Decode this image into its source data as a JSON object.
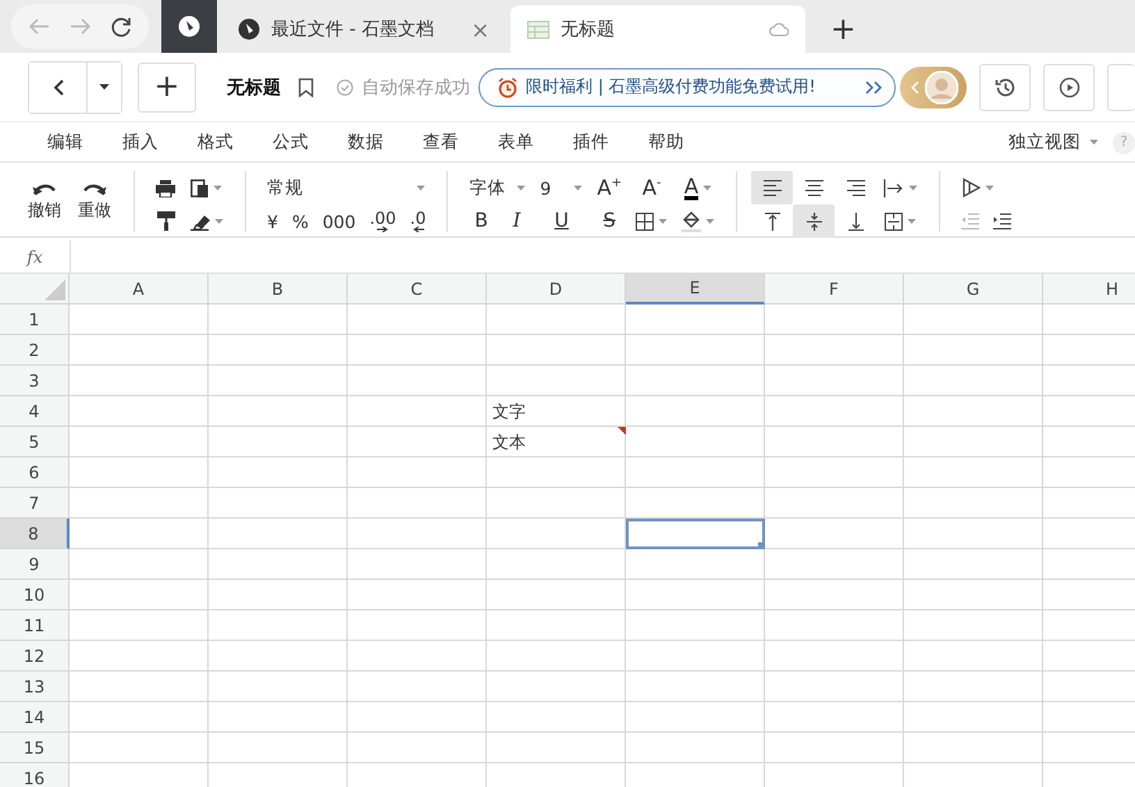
{
  "browser": {
    "tabs": [
      {
        "kind": "app",
        "selected": false
      },
      {
        "kind": "page",
        "label": "最近文件 - 石墨文档",
        "selected": false,
        "close": "×"
      },
      {
        "kind": "sheet",
        "label": "无标题",
        "selected": true
      }
    ],
    "new_tab": "+"
  },
  "doc_bar": {
    "new": "+",
    "title": "无标题",
    "save_status": "自动保存成功",
    "promo": "限时福利 | 石墨高级付费功能免费试用!"
  },
  "menu": {
    "items": [
      "编辑",
      "插入",
      "格式",
      "公式",
      "数据",
      "查看",
      "表单",
      "插件",
      "帮助"
    ],
    "view_mode": "独立视图",
    "help": "?"
  },
  "ribbon": {
    "undo": "撤销",
    "redo": "重做",
    "number_format": "常规",
    "currency": "¥",
    "percent": "%",
    "thousands": "000",
    "add_decimal": ".00",
    "remove_decimal": ".0",
    "font": "字体",
    "font_size": "9",
    "grow_font": "A$^{+}$",
    "shrink_font": "A$^{-}$",
    "font_color": "A",
    "bold": "B",
    "italic": "I",
    "underline": "U",
    "strikethrough": "S",
    "horizontal_align": [
      {
        "kind": "left",
        "selected": true
      },
      {
        "kind": "center",
        "selected": false
      },
      {
        "kind": "right",
        "selected": false
      }
    ],
    "vertical_align": [
      {
        "kind": "top",
        "selected": false
      },
      {
        "kind": "middle",
        "selected": true
      },
      {
        "kind": "bottom",
        "selected": false
      }
    ]
  },
  "formula_bar": {
    "label": "fx"
  },
  "sheet": {
    "columns": [
      {
        "label": "A",
        "selected": false
      },
      {
        "label": "B",
        "selected": false
      },
      {
        "label": "C",
        "selected": false
      },
      {
        "label": "D",
        "selected": false
      },
      {
        "label": "E",
        "selected": true
      },
      {
        "label": "F",
        "selected": false
      },
      {
        "label": "G",
        "selected": false
      },
      {
        "label": "H",
        "selected": false
      }
    ],
    "rows": [
      {
        "label": "1",
        "selected": false
      },
      {
        "label": "2",
        "selected": false
      },
      {
        "label": "3",
        "selected": false
      },
      {
        "label": "4",
        "selected": false,
        "cells": [
          null,
          null,
          null,
          {
            "text": "文字",
            "comment": false
          },
          null,
          null,
          null,
          null
        ]
      },
      {
        "label": "5",
        "selected": false,
        "cells": [
          null,
          null,
          null,
          {
            "text": "文本",
            "comment": true
          },
          null,
          null,
          null,
          null
        ]
      },
      {
        "label": "6",
        "selected": false
      },
      {
        "label": "7",
        "selected": false
      },
      {
        "label": "8",
        "selected": true
      },
      {
        "label": "9",
        "selected": false
      },
      {
        "label": "10",
        "selected": false
      },
      {
        "label": "11",
        "selected": false
      },
      {
        "label": "12",
        "selected": false
      },
      {
        "label": "13",
        "selected": false
      },
      {
        "label": "14",
        "selected": false
      },
      {
        "label": "15",
        "selected": false
      },
      {
        "label": "16",
        "selected": false
      }
    ]
  }
}
